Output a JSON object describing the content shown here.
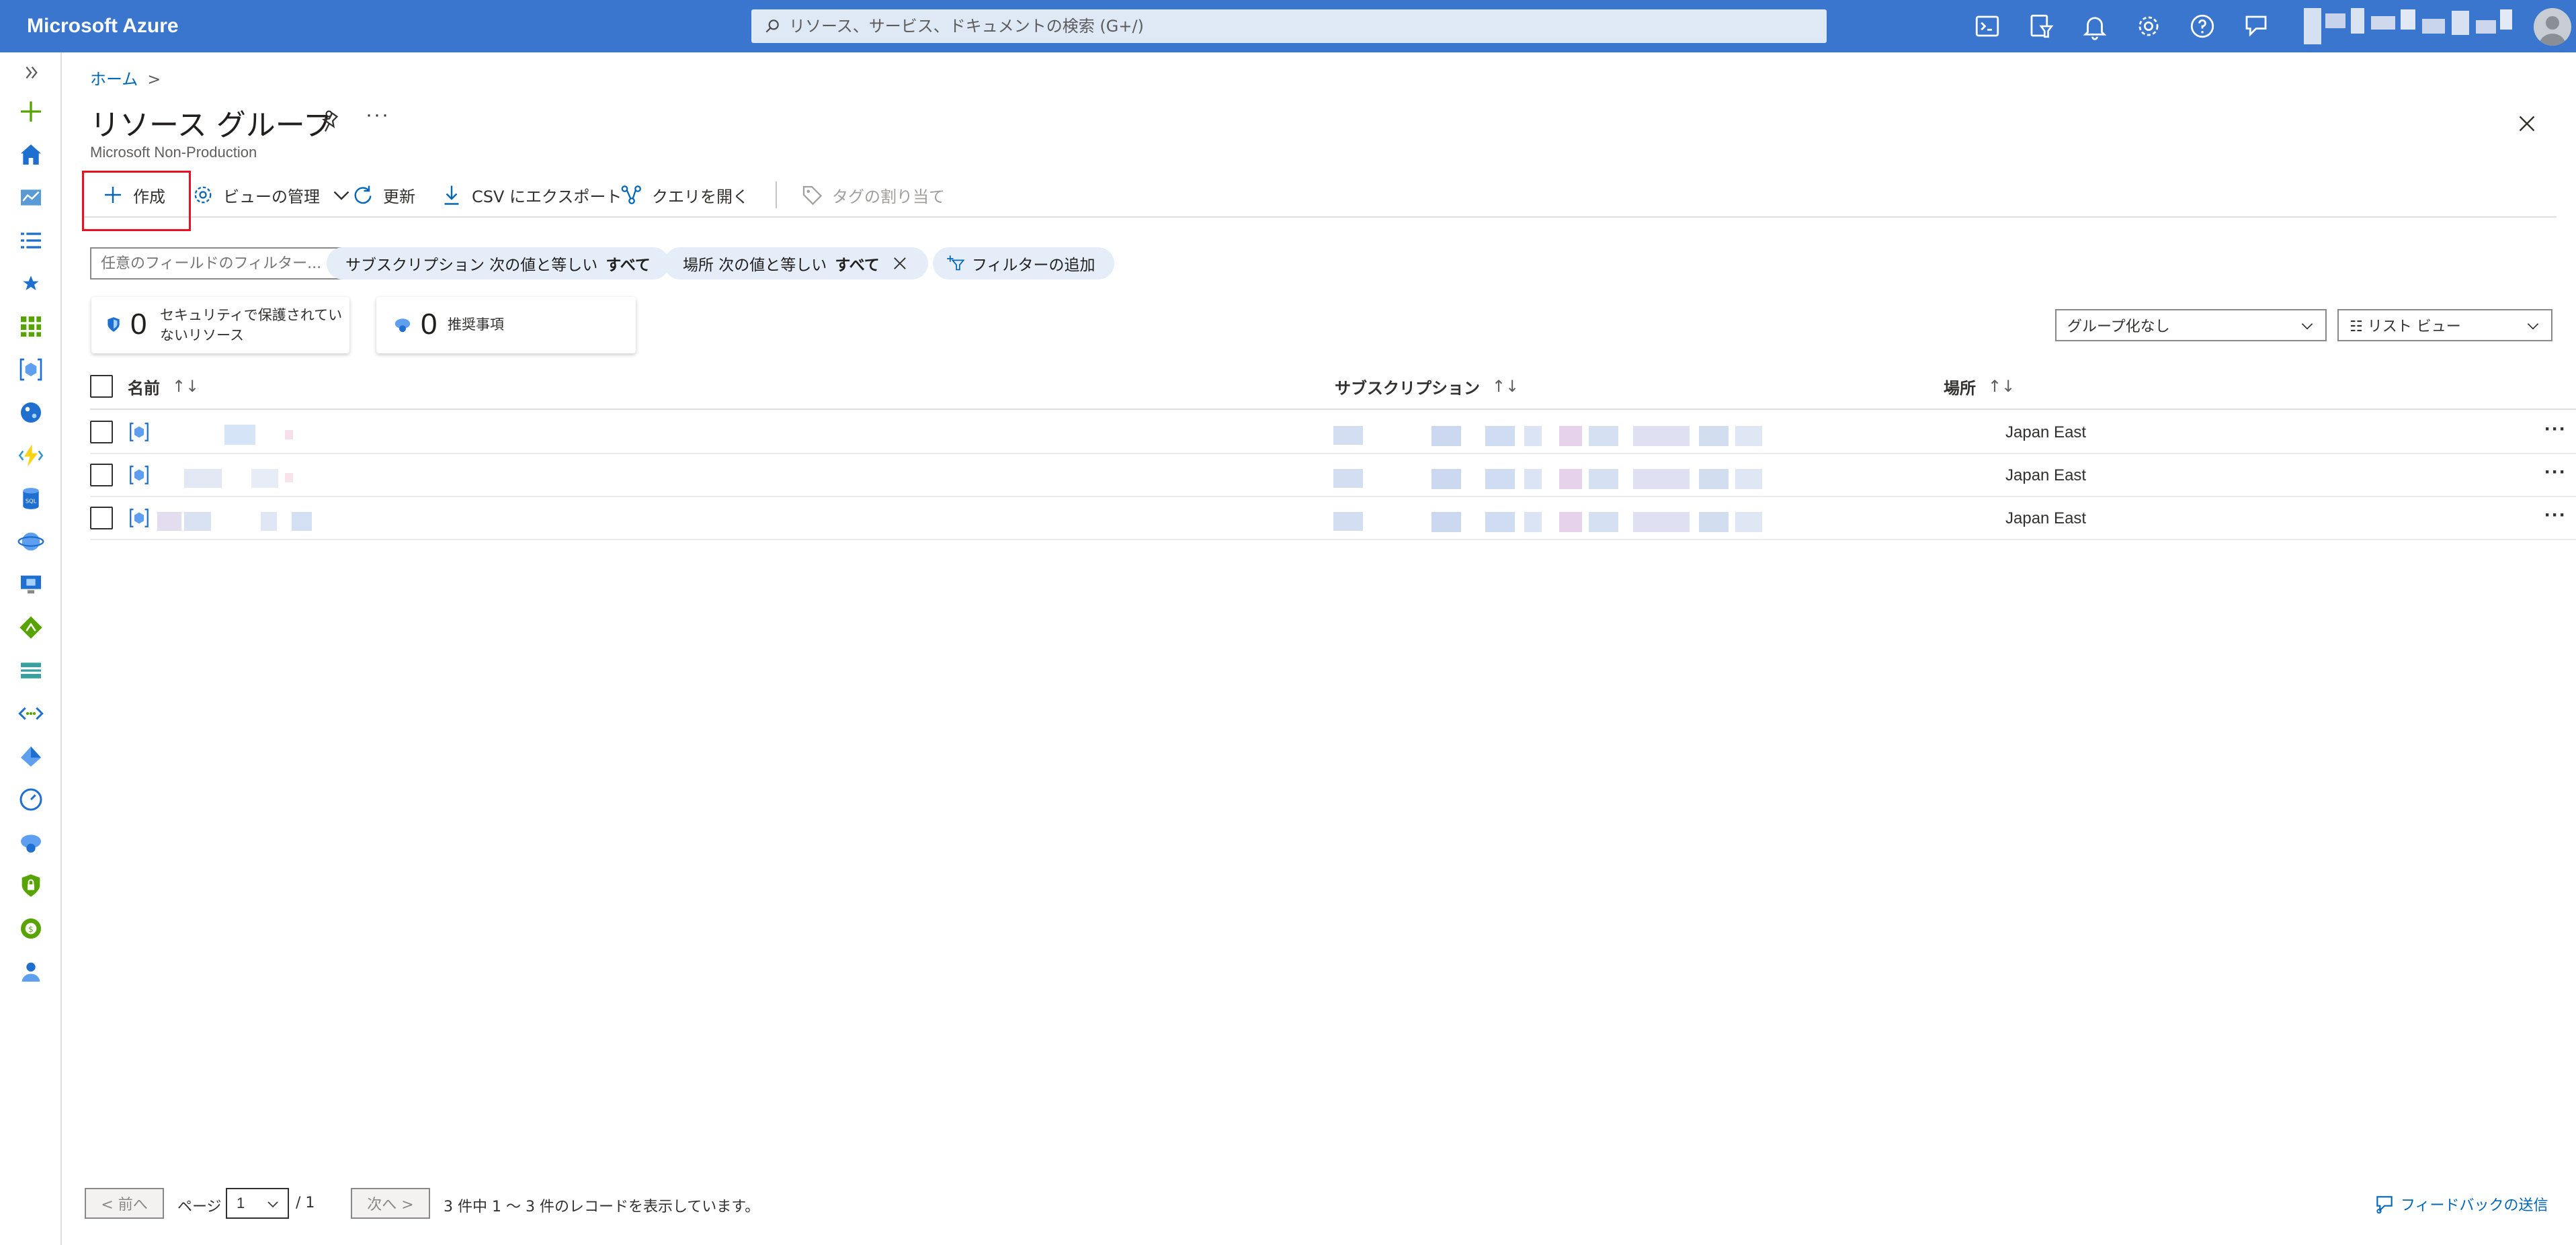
{
  "app": {
    "brand": "Microsoft Azure"
  },
  "search": {
    "placeholder": "リソース、サービス、ドキュメントの検索 (G+/)"
  },
  "topbar_icons": [
    "cloud-shell-icon",
    "directory-filter-icon",
    "notifications-icon",
    "settings-icon",
    "help-icon",
    "feedback-icon"
  ],
  "rail_icons": [
    "expand-icon",
    "create-resource-icon",
    "home-icon",
    "dashboard-icon",
    "all-services-icon",
    "favorites-icon",
    "all-resources-icon",
    "resource-groups-icon",
    "app-services-icon",
    "function-app-icon",
    "sql-database-icon",
    "cosmos-db-icon",
    "virtual-machines-icon",
    "load-balancers-icon",
    "storage-accounts-icon",
    "virtual-networks-icon",
    "entra-id-icon",
    "monitor-icon",
    "advisor-icon",
    "defender-icon",
    "cost-management-icon",
    "help-support-icon"
  ],
  "breadcrumb": {
    "home": "ホーム",
    "separator": ">"
  },
  "page": {
    "title": "リソース グループ",
    "subtitle": "Microsoft Non-Production",
    "more": "···"
  },
  "toolbar": {
    "create": "作成",
    "manage_view": "ビューの管理",
    "refresh": "更新",
    "export_csv": "CSV にエクスポート",
    "open_query": "クエリを開く",
    "assign_tags": "タグの割り当て"
  },
  "filters": {
    "field_filter_placeholder": "任意のフィールドのフィルター...",
    "subscription_pill": {
      "label": "サブスクリプション 次の値と等しい",
      "value": "すべて"
    },
    "location_pill": {
      "label": "場所 次の値と等しい",
      "value": "すべて"
    },
    "add_filter": "フィルターの追加"
  },
  "cards": {
    "security": {
      "count": "0",
      "line1": "セキュリティで保護されてい",
      "line2": "ないリソース"
    },
    "recommendations": {
      "count": "0",
      "label": "推奨事項"
    }
  },
  "grouping": {
    "value": "グループ化なし"
  },
  "view": {
    "value": "☷ リスト ビュー"
  },
  "table": {
    "columns": [
      {
        "label": "名前",
        "sort": "↑↓"
      },
      {
        "label": "サブスクリプション",
        "sort": "↑↓"
      },
      {
        "label": "場所",
        "sort": "↑↓"
      }
    ],
    "rows": [
      {
        "location": "Japan East",
        "more": "···"
      },
      {
        "location": "Japan East",
        "more": "···"
      },
      {
        "location": "Japan East",
        "more": "···"
      }
    ]
  },
  "pager": {
    "prev": "< 前へ",
    "page_label": "ページ",
    "page_value": "1",
    "total": "/ 1",
    "next": "次へ >",
    "summary": "3 件中 1 〜 3 件のレコードを表示しています。"
  },
  "feedback": {
    "label": "フィードバックの送信"
  },
  "colors": {
    "topbar": "#3a76ce",
    "accent": "#0067b8",
    "highlight": "#e81123",
    "pill": "#e4edf8"
  }
}
